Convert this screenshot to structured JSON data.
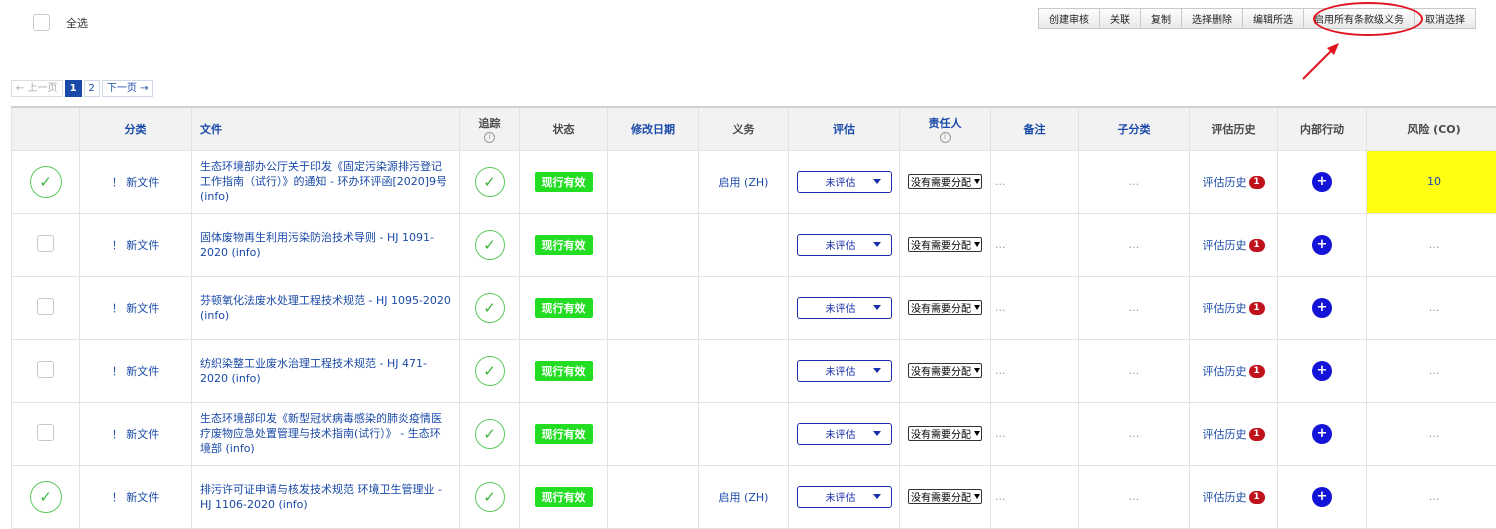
{
  "select_all": {
    "label": "全选"
  },
  "toolbar": {
    "buttons": [
      "创建审核",
      "关联",
      "复制",
      "选择删除",
      "编辑所选",
      "启用所有条款级义务",
      "取消选择"
    ]
  },
  "pager": {
    "prev": "← 上一页",
    "pages": [
      "1",
      "2"
    ],
    "current": "1",
    "next": "下一页 →"
  },
  "table": {
    "columns": [
      "",
      "分类",
      "文件",
      "追踪",
      "状态",
      "修改日期",
      "义务",
      "评估",
      "责任人",
      "备注",
      "子分类",
      "评估历史",
      "内部行动",
      "风险 (CO)"
    ],
    "rows": [
      {
        "selected": true,
        "category": "！ 新文件",
        "document": "生态环境部办公厅关于印发《固定污染源排污登记工作指南（试行）》的通知 - 环办环评函[2020]9号 (info)",
        "status": "现行有效",
        "modified": "",
        "obligation": "启用 (ZH)",
        "evaluation": "未评估",
        "owner": "没有需要分配",
        "note": "...",
        "subcategory": "...",
        "history": "评估历史",
        "history_count": "1",
        "action": "+",
        "risk": "10",
        "risk_highlight": true
      },
      {
        "selected": false,
        "category": "！ 新文件",
        "document": "固体废物再生利用污染防治技术导则 - HJ 1091-2020 (info)",
        "status": "现行有效",
        "modified": "",
        "obligation": "",
        "evaluation": "未评估",
        "owner": "没有需要分配",
        "note": "...",
        "subcategory": "...",
        "history": "评估历史",
        "history_count": "1",
        "action": "+",
        "risk": "...",
        "risk_highlight": false
      },
      {
        "selected": false,
        "category": "！ 新文件",
        "document": "芬顿氧化法废水处理工程技术规范 - HJ 1095-2020 (info)",
        "status": "现行有效",
        "modified": "",
        "obligation": "",
        "evaluation": "未评估",
        "owner": "没有需要分配",
        "note": "...",
        "subcategory": "...",
        "history": "评估历史",
        "history_count": "1",
        "action": "+",
        "risk": "...",
        "risk_highlight": false
      },
      {
        "selected": false,
        "category": "！ 新文件",
        "document": "纺织染整工业废水治理工程技术规范 - HJ 471-2020 (info)",
        "status": "现行有效",
        "modified": "",
        "obligation": "",
        "evaluation": "未评估",
        "owner": "没有需要分配",
        "note": "...",
        "subcategory": "...",
        "history": "评估历史",
        "history_count": "1",
        "action": "+",
        "risk": "...",
        "risk_highlight": false
      },
      {
        "selected": false,
        "category": "！ 新文件",
        "document": "生态环境部印发《新型冠状病毒感染的肺炎疫情医疗废物应急处置管理与技术指南(试行）》 - 生态环境部 (info)",
        "status": "现行有效",
        "modified": "",
        "obligation": "",
        "evaluation": "未评估",
        "owner": "没有需要分配",
        "note": "...",
        "subcategory": "...",
        "history": "评估历史",
        "history_count": "1",
        "action": "+",
        "risk": "...",
        "risk_highlight": false
      },
      {
        "selected": true,
        "category": "！ 新文件",
        "document": "排污许可证申请与核发技术规范 环境卫生管理业 - HJ 1106-2020 (info)",
        "status": "现行有效",
        "modified": "",
        "obligation": "启用 (ZH)",
        "evaluation": "未评估",
        "owner": "没有需要分配",
        "note": "...",
        "subcategory": "...",
        "history": "评估历史",
        "history_count": "1",
        "action": "+",
        "risk": "...",
        "risk_highlight": false
      }
    ]
  },
  "info_glyph": "i",
  "icons": {
    "check": "check-mark-icon",
    "info": "info-circle-icon",
    "plus": "plus-circle-icon",
    "caret": "caret-down-icon"
  },
  "colors": {
    "status_green": "#22dd22",
    "risk_yellow": "#ffff14",
    "link_blue": "#1a4aa8",
    "badge_red": "#c0121c",
    "annotation_red": "#e0141e",
    "plus_blue": "#1414d8"
  }
}
